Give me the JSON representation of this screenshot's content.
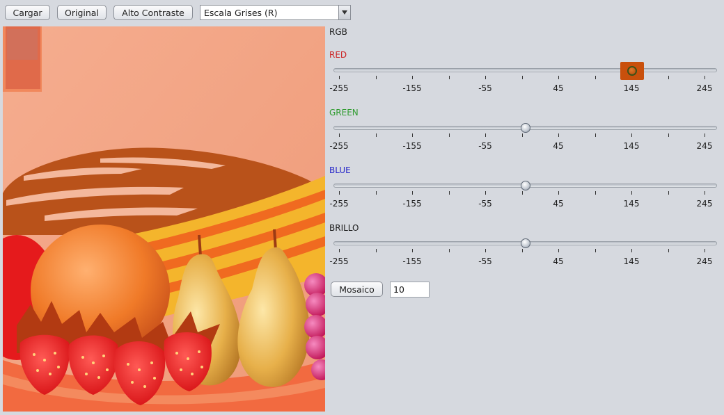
{
  "toolbar": {
    "load_label": "Cargar",
    "original_label": "Original",
    "contrast_label": "Alto Contraste",
    "filter_selected": "Escala Grises (R)"
  },
  "controls": {
    "group_label": "RGB",
    "sliders": [
      {
        "label": "RED",
        "color": "#cc1f1f",
        "value": 145,
        "focused": true
      },
      {
        "label": "GREEN",
        "color": "#2e9b2e",
        "value": 0,
        "focused": false
      },
      {
        "label": "BLUE",
        "color": "#2424c8",
        "value": 0,
        "focused": false
      },
      {
        "label": "BRILLO",
        "color": "#1a1a1a",
        "value": 0,
        "focused": false
      }
    ],
    "tick_labels": [
      "-255",
      "-155",
      "-55",
      "45",
      "145",
      "245"
    ],
    "range": [
      -255,
      255
    ]
  },
  "mosaic": {
    "button_label": "Mosaico",
    "value": "10"
  },
  "icons": {
    "combo_arrow": "chevron-down-icon"
  }
}
